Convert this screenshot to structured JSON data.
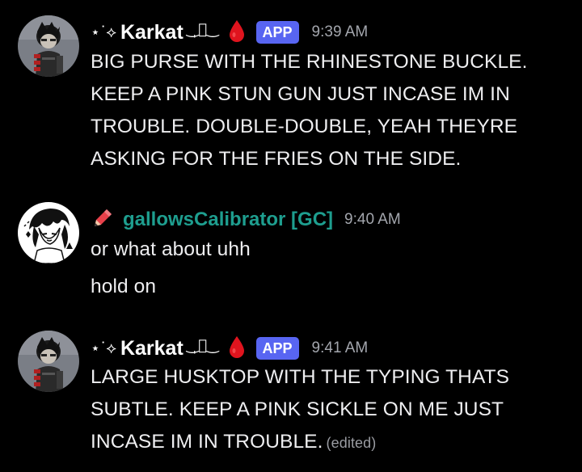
{
  "messages": [
    {
      "sparkle": "⋆˙⟡",
      "author": "Karkat",
      "hook": "‿̩͙‿",
      "badge": "APP",
      "time": "9:39 AM",
      "lines": [
        "BIG PURSE WITH THE RHINESTONE BUCKLE.",
        "KEEP A PINK STUN GUN JUST INCASE IM IN",
        "TROUBLE. DOUBLE-DOUBLE, YEAH THEYRE",
        "ASKING FOR THE FRIES ON THE SIDE."
      ]
    },
    {
      "author": "gallowsCalibrator [GC]",
      "author_color": "#1e9e8f",
      "time": "9:40 AM",
      "lines": [
        "or what about uhh",
        "hold on"
      ]
    },
    {
      "sparkle": "⋆˙⟡",
      "author": "Karkat",
      "hook": "‿̩͙‿",
      "badge": "APP",
      "time": "9:41 AM",
      "lines": [
        "LARGE HUSKTOP WITH THE TYPING THATS",
        "SUBTLE. KEEP A PINK SICKLE ON ME JUST",
        "INCASE IM IN TROUBLE."
      ],
      "edited": "(edited)"
    }
  ],
  "colors": {
    "background": "#000000",
    "app_badge": "#5865f2",
    "blood_drop": "#e0141e",
    "pencil": "#e8404a"
  },
  "icons": [
    "karkat-avatar",
    "blood-drop-icon",
    "pencil-icon",
    "gallows-avatar"
  ]
}
